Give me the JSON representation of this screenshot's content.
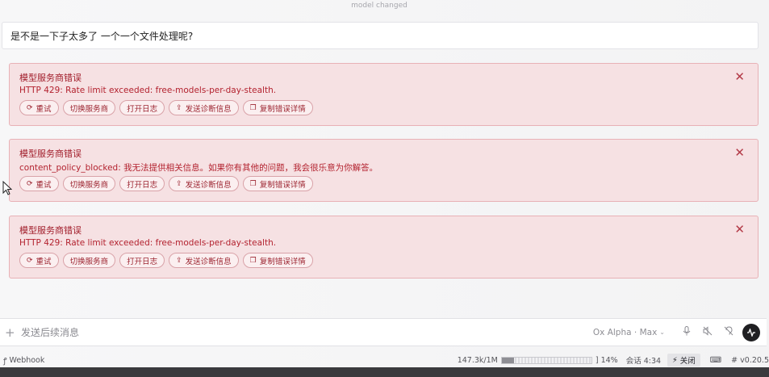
{
  "header": {
    "model_changed": "model changed"
  },
  "user_message": "是不是一下子太多了 一个一个文件处理呢?",
  "errors": [
    {
      "title": "模型服务商错误",
      "message": "HTTP 429: Rate limit exceeded: free-models-per-day-stealth."
    },
    {
      "title": "模型服务商错误",
      "message": "content_policy_blocked: 我无法提供相关信息。如果你有其他的问题，我会很乐意为你解答。"
    },
    {
      "title": "模型服务商错误",
      "message": "HTTP 429: Rate limit exceeded: free-models-per-day-stealth."
    }
  ],
  "actions": {
    "retry": "重试",
    "switch_provider": "切换服务商",
    "open_log": "打开日志",
    "send_diagnostics": "发送诊断信息",
    "copy_details": "复制错误详情"
  },
  "composer": {
    "placeholder": "发送后续消息",
    "model": "Ox Alpha · Max"
  },
  "status": {
    "webhook": "Webhook",
    "tokens": "147.3k/1M",
    "token_usage_pct": 14,
    "token_percent_label": "] 14%",
    "session": "会话 4:34",
    "close": "关闭",
    "version": "# v0.20.5"
  }
}
